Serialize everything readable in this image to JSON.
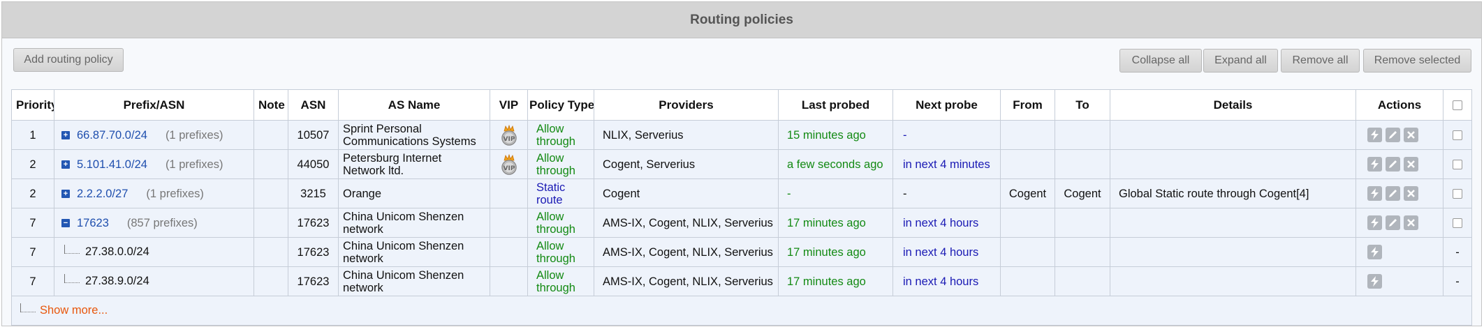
{
  "panel": {
    "title": "Routing policies"
  },
  "toolbar": {
    "add_label": "Add routing policy",
    "collapse_all_label": "Collapse all",
    "expand_all_label": "Expand all",
    "remove_all_label": "Remove all",
    "remove_selected_label": "Remove selected"
  },
  "table": {
    "columns": {
      "priority": "Priority",
      "prefix": "Prefix/ASN",
      "note": "Note",
      "asn": "ASN",
      "as_name": "AS Name",
      "vip": "VIP",
      "policy_type": "Policy Type",
      "providers": "Providers",
      "last_probed": "Last probed",
      "next_probe": "Next probe",
      "from": "From",
      "to": "To",
      "details": "Details",
      "actions": "Actions"
    },
    "rows": [
      {
        "priority": "1",
        "prefix": "66.87.70.0/24",
        "prefix_count": "(1 prefixes)",
        "note": "",
        "asn": "10507",
        "as_name": "Sprint Personal Communications Systems",
        "vip": true,
        "policy_type": "Allow through",
        "providers": "NLIX, Serverius",
        "last_probed": "15 minutes ago",
        "next_probe": "-",
        "from": "",
        "to": "",
        "details": ""
      },
      {
        "priority": "2",
        "prefix": "5.101.41.0/24",
        "prefix_count": "(1 prefixes)",
        "note": "",
        "asn": "44050",
        "as_name": "Petersburg Internet Network ltd.",
        "vip": true,
        "policy_type": "Allow through",
        "providers": "Cogent, Serverius",
        "last_probed": "a few seconds ago",
        "next_probe": "in next 4 minutes",
        "from": "",
        "to": "",
        "details": ""
      },
      {
        "priority": "2",
        "prefix": "2.2.2.0/27",
        "prefix_count": "(1 prefixes)",
        "note": "",
        "asn": "3215",
        "as_name": "Orange",
        "vip": false,
        "policy_type": "Static route",
        "providers": "Cogent",
        "last_probed": "-",
        "next_probe": "-",
        "from": "Cogent",
        "to": "Cogent",
        "details": "Global Static route through Cogent[4]"
      },
      {
        "priority": "7",
        "prefix": "17623",
        "prefix_count": "(857 prefixes)",
        "note": "",
        "asn": "17623",
        "as_name": "China Unicom Shenzen network",
        "vip": false,
        "policy_type": "Allow through",
        "providers": "AMS-IX, Cogent, NLIX, Serverius",
        "last_probed": "17 minutes ago",
        "next_probe": "in next 4 hours",
        "from": "",
        "to": "",
        "details": ""
      },
      {
        "priority": "7",
        "prefix": "27.38.0.0/24",
        "note": "",
        "asn": "17623",
        "as_name": "China Unicom Shenzen network",
        "vip": false,
        "policy_type": "Allow through",
        "providers": "AMS-IX, Cogent, NLIX, Serverius",
        "last_probed": "17 minutes ago",
        "next_probe": "in next 4 hours",
        "from": "",
        "to": "",
        "details": "",
        "no_select": "-"
      },
      {
        "priority": "7",
        "prefix": "27.38.9.0/24",
        "note": "",
        "asn": "17623",
        "as_name": "China Unicom Shenzen network",
        "vip": false,
        "policy_type": "Allow through",
        "providers": "AMS-IX, Cogent, NLIX, Serverius",
        "last_probed": "17 minutes ago",
        "next_probe": "in next 4 hours",
        "from": "",
        "to": "",
        "details": "",
        "no_select": "-"
      }
    ],
    "show_more": "Show more..."
  },
  "icons": {
    "expand": "plus-square-icon",
    "collapse": "minus-square-icon",
    "vip": "crown-vip-badge-icon",
    "probe": "lightning-icon",
    "edit": "pencil-icon",
    "remove": "close-x-icon"
  },
  "colors": {
    "header_bg": "#d4d4d4",
    "link_blue": "#1f4fae",
    "status_green": "#138a13",
    "status_blue": "#1a1ab4",
    "show_more": "#e8570d",
    "action_gray": "#b0b5bc"
  }
}
